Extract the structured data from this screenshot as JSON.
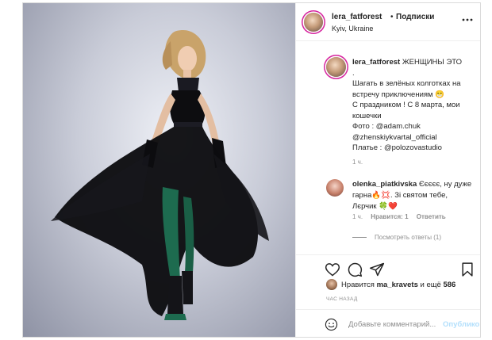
{
  "post": {
    "header": {
      "username": "lera_fatforest",
      "separator": "•",
      "follow_label": "Подписки",
      "location": "Kyiv, Ukraine",
      "more_icon": "more-horizontal-icon"
    },
    "caption": {
      "username": "lera_fatforest",
      "lines": [
        "ЖЕНЩИНЫ ЭТО",
        ".",
        "Шагать в зелёных колготках на",
        "встречу приключениям 😁",
        "С праздником ! С 8 марта, мои",
        "кошечки",
        "Фото : @adam.chuk",
        "@zhenskiykvartal_official",
        "Платье : @polozovastudio"
      ],
      "time": "1 ч."
    },
    "reply": {
      "username": "olenka_piatkivska",
      "line1": "Єєєєє, ну дуже",
      "line2": "гарна🔥💢. Зі святом тебе,",
      "line3": "Лєрчик 🍀❤️",
      "time": "1 ч.",
      "likes": "Нравится: 1",
      "reply_label": "Ответить",
      "view_replies": "Посмотреть ответы (1)"
    },
    "actions": {
      "like_icon": "heart-icon",
      "comment_icon": "comment-icon",
      "share_icon": "share-icon",
      "save_icon": "bookmark-icon"
    },
    "likes": {
      "prefix": "Нравится",
      "user": "ma_kravets",
      "suffix": "и ещё",
      "count": "586"
    },
    "time_ago": "ЧАС НАЗАД",
    "add_comment": {
      "placeholder": "Добавьте комментарий...",
      "post_label": "Опубликовать",
      "emoji_icon": "emoji-smile-icon"
    },
    "colors": {
      "text": "#262626",
      "muted": "#8e8e8e",
      "border": "#dbdbdb",
      "post_button_disabled": "#b2dffc",
      "dress": "#0d0d10",
      "tights": "#1d6b4f"
    }
  }
}
